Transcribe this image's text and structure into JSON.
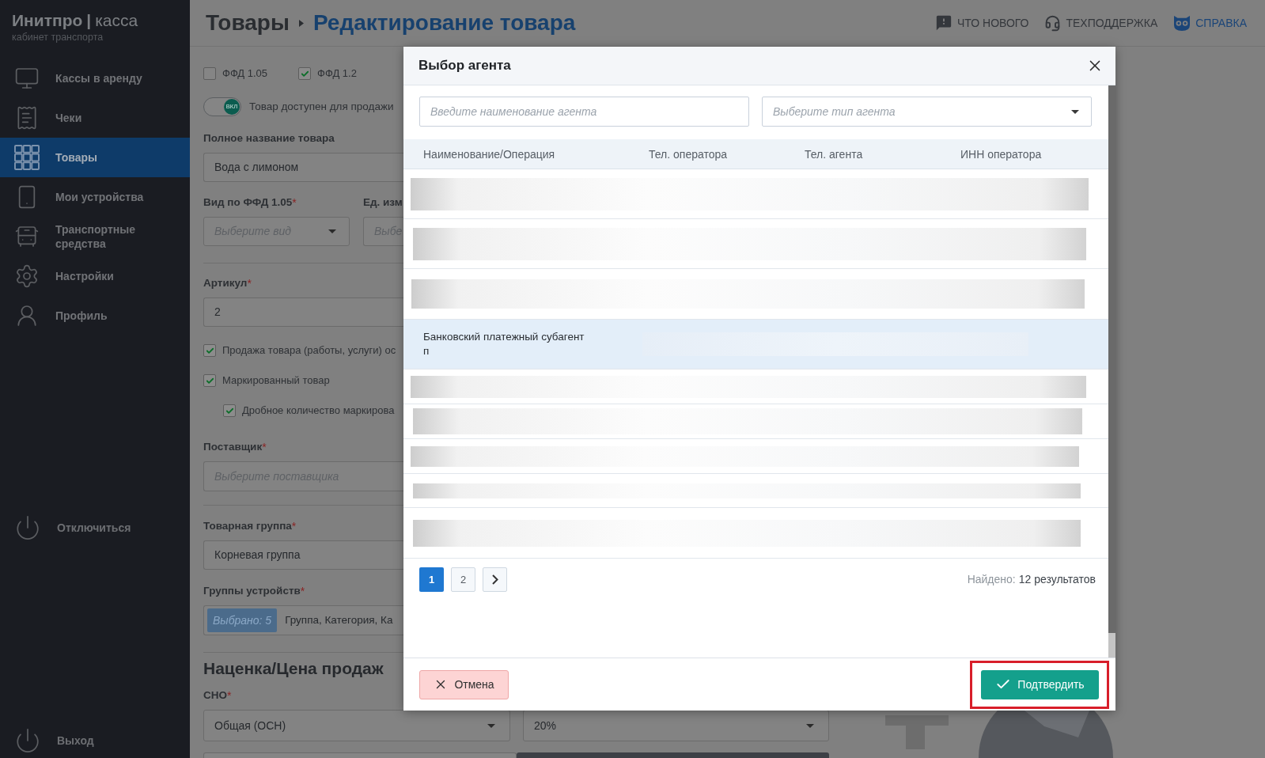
{
  "sidebar": {
    "logo": {
      "brand": "Инитпро",
      "separator": "|",
      "product": "касса"
    },
    "subtitle": "кабинет транспорта",
    "items": [
      {
        "label": "Кассы в аренду",
        "selected": false
      },
      {
        "label": "Чеки",
        "selected": false
      },
      {
        "label": "Товары",
        "selected": true
      },
      {
        "label": "Мои устройства",
        "selected": false
      },
      {
        "label": "Транспортные средства",
        "selected": false
      },
      {
        "label": "Настройки",
        "selected": false
      },
      {
        "label": "Профиль",
        "selected": false
      }
    ],
    "bottom_items": [
      {
        "label": "Отключиться"
      },
      {
        "label": "Выход"
      }
    ]
  },
  "header": {
    "breadcrumb": [
      {
        "label": "Товары",
        "current": false
      },
      {
        "label": "Редактирование товара",
        "current": true
      }
    ],
    "links": [
      {
        "label": "ЧТО НОВОГО",
        "accent": false
      },
      {
        "label": "ТЕХПОДДЕРЖКА",
        "accent": false
      },
      {
        "label": "СПРАВКА",
        "accent": true
      }
    ]
  },
  "form": {
    "ffd_versions": [
      {
        "label": "ФФД 1.05",
        "checked": false
      },
      {
        "label": "ФФД 1.2",
        "checked": true
      }
    ],
    "availability": {
      "on": true,
      "knob_label": "ВКЛ",
      "label": "Товар доступен для продажи"
    },
    "full_name": {
      "label": "Полное название товара",
      "value": "Вода с лимоном"
    },
    "ffd_kind": {
      "label": "Вид по ФФД 1.05",
      "mark": "*",
      "placeholder": "Выберите вид"
    },
    "unit": {
      "label": "Ед. изм",
      "placeholder": "Выбе"
    },
    "article": {
      "label": "Артикул",
      "mark": "*",
      "value": "2"
    },
    "flags": [
      {
        "label": "Продажа товара (работы, услуги) ос",
        "checked": true
      },
      {
        "label": "Маркированный товар",
        "checked": true,
        "children": [
          {
            "label": "Дробное количество маркирова",
            "checked": true
          }
        ]
      }
    ],
    "supplier": {
      "label": "Поставщик",
      "mark": "*",
      "placeholder": "Выберите поставщика"
    },
    "product_group": {
      "label": "Товарная группа",
      "mark": "*",
      "value": "Корневая группа"
    },
    "device_groups": {
      "label": "Группы устройств",
      "mark": "*",
      "badge": "Выбрано: 5",
      "value": "Группа, Категория, Ка"
    },
    "section_title": "Наценка/Цена продаж",
    "tax_system": {
      "label": "СНО",
      "mark": "*",
      "value": "Общая (ОСН)"
    },
    "vat": {
      "value": "20%"
    }
  },
  "modal": {
    "title": "Выбор агента",
    "search": {
      "placeholder": "Введите наименование агента"
    },
    "agent_type": {
      "placeholder": "Выберите тип агента"
    },
    "table": {
      "columns": [
        "Наименование/Операция",
        "Тел. оператора",
        "Тел. агента",
        "ИНН оператора"
      ],
      "rows": [
        {
          "kind": "blurred",
          "selected": false
        },
        {
          "kind": "blurred",
          "selected": false
        },
        {
          "kind": "blurred",
          "selected": false
        },
        {
          "kind": "agent",
          "name": "Банковский платежный субагент п",
          "selected": true
        },
        {
          "kind": "blurred",
          "selected": false
        },
        {
          "kind": "blurred",
          "selected": false
        },
        {
          "kind": "blurred",
          "selected": false
        },
        {
          "kind": "blurred",
          "selected": false
        },
        {
          "kind": "blurred",
          "selected": false
        }
      ]
    },
    "pagination": {
      "pages": [
        {
          "label": "1",
          "selected": true
        },
        {
          "label": "2",
          "selected": false
        }
      ],
      "found_label": "Найдено:",
      "found_value": "12 результатов"
    },
    "buttons": [
      {
        "kind": "cancel",
        "label": "Отмена",
        "highlighted": false
      },
      {
        "kind": "confirm",
        "label": "Подтвердить",
        "highlighted": true
      }
    ]
  }
}
